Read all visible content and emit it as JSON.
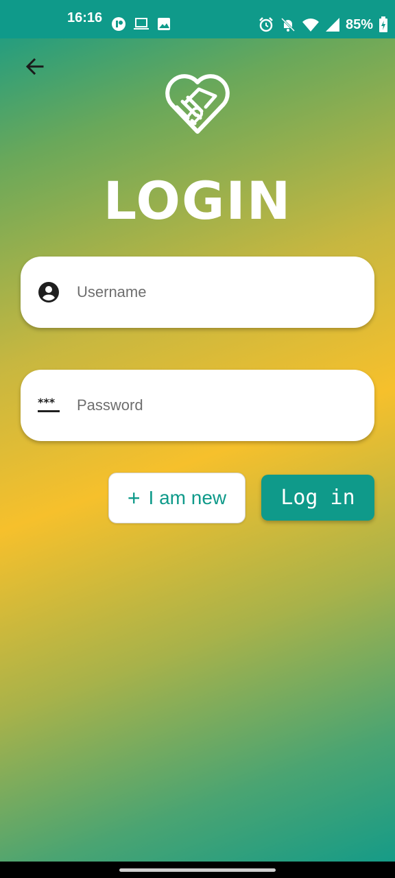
{
  "status_bar": {
    "time": "16:16",
    "battery": "85%",
    "left_icons": [
      "notification-app-icon",
      "laptop-icon",
      "image-icon"
    ],
    "right_icons": [
      "alarm-icon",
      "bell-off-icon",
      "wifi-icon",
      "signal-icon",
      "battery-charging-icon"
    ]
  },
  "header": {
    "back_icon": "arrow-left-icon",
    "logo": "heart-handshake-icon",
    "title": "LOGIN"
  },
  "form": {
    "username": {
      "placeholder": "Username",
      "value": "",
      "icon": "account-circle-icon"
    },
    "password": {
      "placeholder": "Password",
      "value": "",
      "icon": "password-icon"
    }
  },
  "actions": {
    "new_label": "I am new",
    "new_icon": "plus-icon",
    "login_label": "Log in"
  },
  "colors": {
    "primary": "#0f9a8a",
    "accent_yellow": "#f6c02c",
    "white": "#ffffff"
  }
}
